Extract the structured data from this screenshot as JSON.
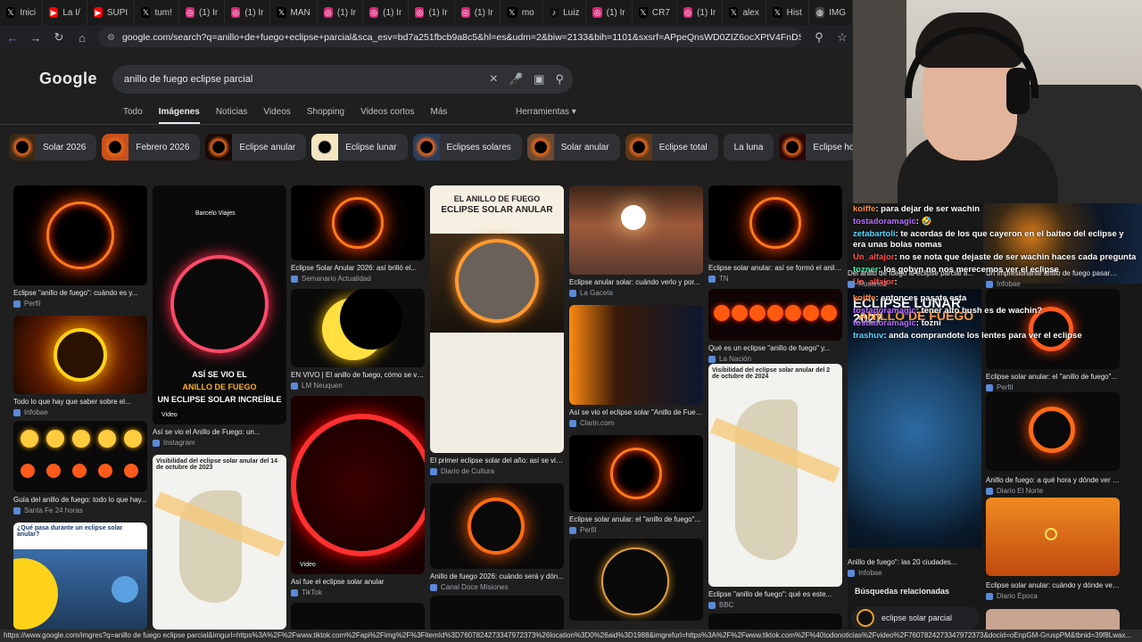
{
  "browser": {
    "tabs": [
      {
        "icon": "x",
        "label": "Inici"
      },
      {
        "icon": "youtube",
        "label": "La I/"
      },
      {
        "icon": "youtube",
        "label": "SUPI"
      },
      {
        "icon": "x",
        "label": "tum!"
      },
      {
        "icon": "instagram",
        "label": "(1) Ir"
      },
      {
        "icon": "instagram",
        "label": "(1) Ir"
      },
      {
        "icon": "x",
        "label": "MAN"
      },
      {
        "icon": "instagram",
        "label": "(1) Ir"
      },
      {
        "icon": "instagram",
        "label": "(1) Ir"
      },
      {
        "icon": "instagram",
        "label": "(1) Ir"
      },
      {
        "icon": "instagram",
        "label": "(1) Ir"
      },
      {
        "icon": "x",
        "label": "mo"
      },
      {
        "icon": "tiktok",
        "label": "Luiz"
      },
      {
        "icon": "instagram",
        "label": "(1) Ir"
      },
      {
        "icon": "x",
        "label": "CR7"
      },
      {
        "icon": "instagram",
        "label": "(1) Ir"
      },
      {
        "icon": "x",
        "label": "alex"
      },
      {
        "icon": "x",
        "label": "Hist"
      },
      {
        "icon": "globe",
        "label": "IMG"
      }
    ],
    "url": "google.com/search?q=anillo+de+fuego+eclipse+parcial&sca_esv=bd7a251fbcb9a8c5&hl=es&udm=2&biw=2133&bih=1101&sxsrf=APpeQnsWD0ZIZ6ocXPtV4FnDSZZ5oKMZ8g%3A178..."
  },
  "google": {
    "logo": "Google",
    "query": "anillo de fuego eclipse parcial",
    "tabs": [
      "Todo",
      "Imágenes",
      "Noticias",
      "Videos",
      "Shopping",
      "Videos cortos",
      "Más"
    ],
    "active_tab": "Imágenes",
    "tools": "Herramientas",
    "chips": [
      "Solar 2026",
      "Febrero 2026",
      "Eclipse anular",
      "Eclipse lunar",
      "Eclipses solares",
      "Solar anular",
      "Eclipse total",
      "La luna",
      "Eclipse hoy",
      "Solar eclipse"
    ],
    "results": [
      {
        "caption": "Eclipse \"anillo de fuego\": cuándo es y...",
        "source": "Perfil"
      },
      {
        "caption": "Todo lo que hay que saber sobre el...",
        "source": "Infobae"
      },
      {
        "caption": "Guía del anillo de fuego: todo lo que hay...",
        "source": "Santa Fe 24 horas"
      },
      {
        "caption": "Así se vio el Anillo de Fuego: un...",
        "source": "Instagram"
      },
      {
        "caption": "Eclipse Solar Anular 2026: así brilló el...",
        "source": "Semanario Actualidad"
      },
      {
        "caption": "EN VIVO | El anillo de fuego, cómo se vio ...",
        "source": "LM Neuquen"
      },
      {
        "caption": "Así fue el eclipse solar anular",
        "source": "TikTok"
      },
      {
        "caption": "El primer eclipse solar del año: así se vio...",
        "source": "Diario de Cultura"
      },
      {
        "caption": "Anillo de fuego 2026: cuándo será y dón...",
        "source": "Canal Doce Misiones"
      },
      {
        "caption": "Eclipse anular solar: cuándo verlo y por...",
        "source": "La Gaceta"
      },
      {
        "caption": "Así se vio el eclipse solar \"Anillo de Fueg...",
        "source": "Clarin.com"
      },
      {
        "caption": "Eclipse solar anular: el \"anillo de fuego\"...",
        "source": "Perfil"
      },
      {
        "caption": "Eclipse solar anular: así se formó el anillo...",
        "source": "TN"
      },
      {
        "caption": "Qué es un eclipse \"anillo de fuego\" y...",
        "source": "La Nación"
      },
      {
        "caption": "Eclipse \"anillo de fuego\": qué es este...",
        "source": "BBC"
      },
      {
        "caption": "Anillo de fuego\": las 20 ciudades...",
        "source": "Infobae"
      },
      {
        "caption": "Eclipse solar anular: el \"anillo de fuego\"...",
        "source": "Perfil"
      },
      {
        "caption": "Anillo de fuego: a qué hora y dónde ver e...",
        "source": "Diario El Norte"
      },
      {
        "caption": "Eclipse solar anular: cuándo y dónde ver...",
        "source": "Diario Época"
      },
      {
        "caption": "Del anillo de fuego al eclipse parcial a...",
        "source": "Rosario3"
      },
      {
        "caption": "Un impresionante anillo de fuego pasará...",
        "source": "Infobae"
      }
    ],
    "image_text": {
      "ring_banner_1": "EL ANILLO DE FUEGO",
      "ring_banner_2": "ECLIPSE SOLAR ANULAR",
      "video_label": "Video",
      "instagram_text_1": "ASÍ SE VIO EL",
      "instagram_text_2": "ANILLO DE FUEGO",
      "instagram_text_3": "UN ECLIPSE SOLAR INCREÍBLE",
      "brand": "Barcelo Viajes",
      "map_title": "Visibilidad del eclipse solar anular del 14 de octubre de 2023",
      "map_title_2": "Visibilidad del eclipse solar anular del 2 de octubre de 2024",
      "question_title": "¿Qué pasa durante un eclipse solar anular?",
      "lunar_title": "ECLIPSE LUNAR 2027",
      "lunar_sub": "ANILLO DE FUEGO"
    },
    "related_title": "Búsquedas relacionadas",
    "related": [
      "eclipse solar parcial"
    ]
  },
  "status_url": "https://www.google.com/imgres?q=anillo de fuego eclipse parcial&imgurl=https%3A%2F%2Fwww.tiktok.com%2Fapi%2Fimg%2F%3FitemId%3D7607824273347972373%26location%3D0%26aid%3D1988&imgrefurl=https%3A%2F%2Fwww.tiktok.com%2F%40todonoticias%2Fvideo%2F7607824273347972373&docid=oEnpGM-GruspPM&tbnid=39f8Lwax...",
  "chat": [
    {
      "user": "koiffe",
      "text": "para dejar de ser wachin",
      "color": "#ff8a3d"
    },
    {
      "user": "tostadoramagic",
      "text": "🤣",
      "color": "#b56cff"
    },
    {
      "user": "zetabartoli",
      "text": "te acordas de los que cayeron en el baiteo del eclipse y era unas bolas nomas",
      "color": "#57d6ff"
    },
    {
      "user": "Un_alfajor",
      "text": "no se nota que dejaste de ser wachin haces cada pregunta",
      "color": "#ff4a4a"
    },
    {
      "user": "tozner",
      "text": "los gobyn no nos merecemos ver el eclipse",
      "color": "#2ff2a8"
    },
    {
      "user": "Un_alfajor",
      "text": "",
      "color": "#ff4a4a"
    },
    {
      "user": "koiffe",
      "text": "entonces pasate esta",
      "color": "#ff8a3d"
    },
    {
      "user": "tostadoramagic",
      "text": "tener alto bush es de wachin?",
      "color": "#b56cff"
    },
    {
      "user": "tostadoramagic",
      "text": "tozni",
      "color": "#b56cff"
    },
    {
      "user": "trashuv",
      "text": "anda comprandote los lentes para ver el eclipse",
      "color": "#57d6ff"
    }
  ]
}
